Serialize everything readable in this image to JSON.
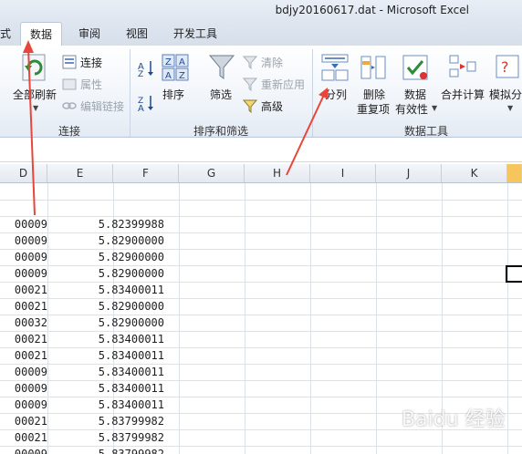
{
  "window": {
    "title": "bdjy20160617.dat - Microsoft Excel"
  },
  "tabs": [
    {
      "label": "式"
    },
    {
      "label": "数据"
    },
    {
      "label": "审阅"
    },
    {
      "label": "视图"
    },
    {
      "label": "开发工具"
    }
  ],
  "ribbon": {
    "connections": {
      "refresh_all": "全部刷新",
      "connections": "连接",
      "properties": "属性",
      "edit_links": "编辑链接",
      "group_label": "连接"
    },
    "sort_filter": {
      "sort": "排序",
      "filter": "筛选",
      "clear": "清除",
      "reapply": "重新应用",
      "advanced": "高级",
      "group_label": "排序和筛选"
    },
    "data_tools": {
      "text_to_columns": "分列",
      "remove_duplicates_line1": "删除",
      "remove_duplicates_line2": "重复项",
      "data_validation_line1": "数据",
      "data_validation_line2": "有效性",
      "consolidate": "合并计算",
      "what_if": "模拟分",
      "group_label": "数据工具"
    }
  },
  "columns": [
    "D",
    "E",
    "F",
    "G",
    "H",
    "I",
    "J",
    "K"
  ],
  "rows": [
    {
      "d": "00009",
      "e": "5.82399988"
    },
    {
      "d": "00009",
      "e": "5.82900000"
    },
    {
      "d": "00009",
      "e": "5.82900000"
    },
    {
      "d": "00009",
      "e": "5.82900000"
    },
    {
      "d": "00021",
      "e": "5.83400011"
    },
    {
      "d": "00021",
      "e": "5.82900000"
    },
    {
      "d": "00032",
      "e": "5.82900000"
    },
    {
      "d": "00021",
      "e": "5.83400011"
    },
    {
      "d": "00021",
      "e": "5.83400011"
    },
    {
      "d": "00009",
      "e": "5.83400011"
    },
    {
      "d": "00009",
      "e": "5.83400011"
    },
    {
      "d": "00009",
      "e": "5.83400011"
    },
    {
      "d": "00021",
      "e": "5.83799982"
    },
    {
      "d": "00021",
      "e": "5.83799982"
    },
    {
      "d": "00009",
      "e": "5.83799982"
    }
  ],
  "watermark": "Baidu 经验",
  "colors": {
    "annotation_arrow": "#e8463a",
    "selection_cell": "#000000"
  }
}
